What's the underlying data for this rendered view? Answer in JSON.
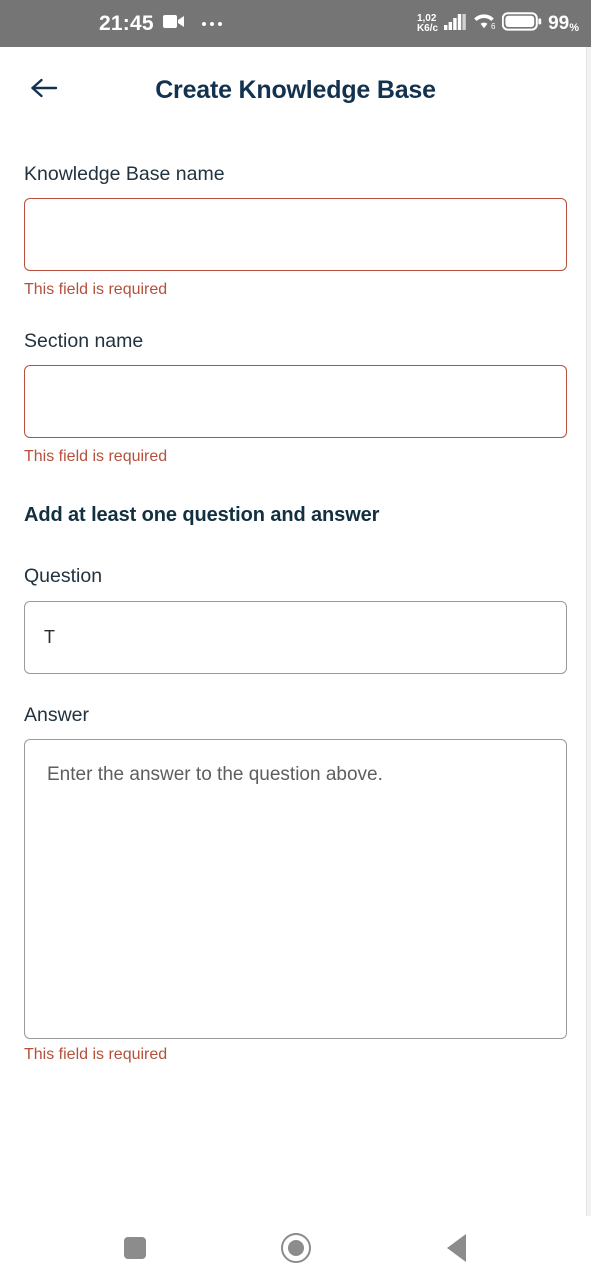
{
  "status_bar": {
    "time": "21:45",
    "recording_icon": "video-camera-icon",
    "more_notifications_icon": "overflow-dots-icon",
    "network_speed_value": "1,02",
    "network_speed_unit": "K6/c",
    "signal_icon": "cellular-signal-icon",
    "wifi_icon": "wifi-icon",
    "battery_icon": "battery-icon",
    "battery_percent": "99",
    "percent_symbol": "%",
    "background_color": "#757575"
  },
  "appbar": {
    "back_icon": "arrow-left-icon",
    "title": "Create Knowledge Base",
    "title_color": "#133250"
  },
  "form": {
    "kb_name": {
      "label": "Knowledge Base name",
      "value": "",
      "placeholder": "",
      "error": "This field is required",
      "state": "error"
    },
    "section_name": {
      "label": "Section name",
      "value": "",
      "placeholder": "",
      "error": "This field is required",
      "state": "error"
    },
    "qa_heading": "Add at least one question and answer",
    "question": {
      "label": "Question",
      "value": "T",
      "placeholder": "",
      "state": "normal"
    },
    "answer": {
      "label": "Answer",
      "value": "",
      "placeholder": "Enter the answer to the question above.",
      "error": "This field is required",
      "state": "normal"
    }
  },
  "nav_bar": {
    "recents_icon": "square-recents-icon",
    "home_icon": "circle-home-icon",
    "back_icon": "triangle-back-icon"
  },
  "colors": {
    "error": "#b5503c",
    "title": "#133250",
    "label": "#22333f",
    "border_normal": "#9a9a9a",
    "status_bg": "#757575",
    "nav_icon": "#8c8c8c"
  }
}
